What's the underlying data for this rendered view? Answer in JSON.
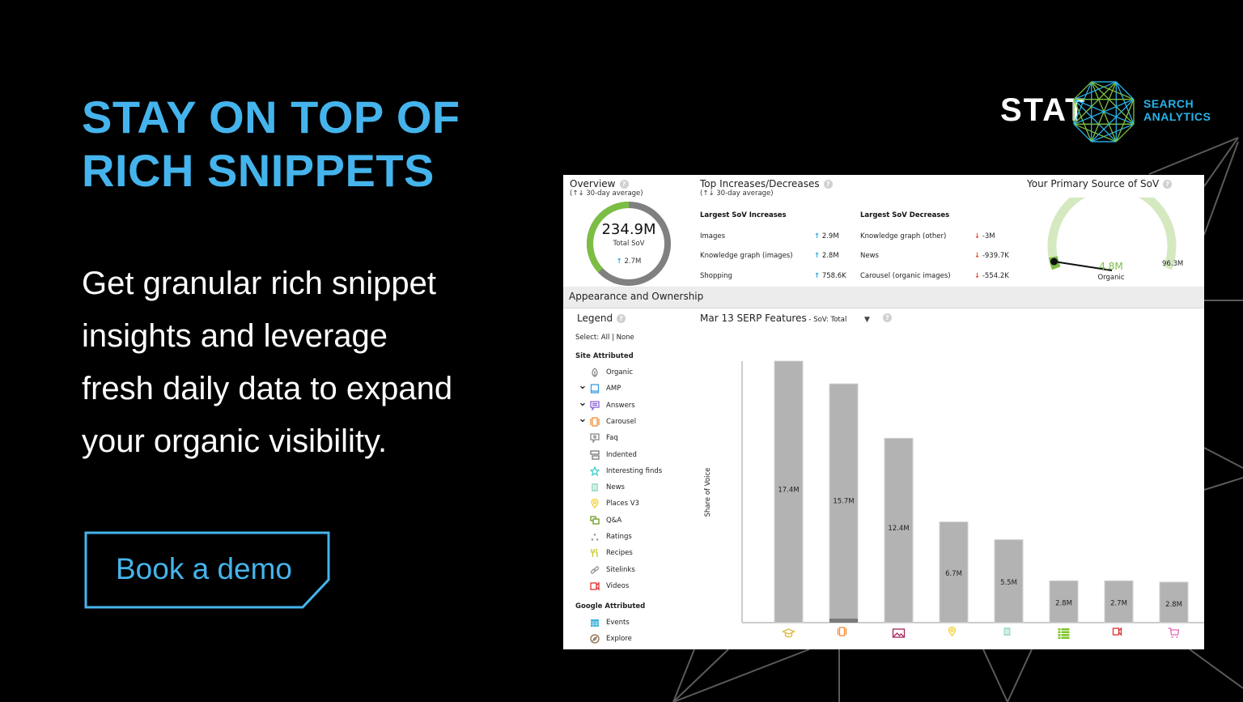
{
  "headline": [
    "STAY ON TOP OF",
    "RICH SNIPPETS"
  ],
  "subcopy": [
    "Get granular rich snippet",
    "insights and leverage",
    "fresh daily data to expand",
    "your organic visibility."
  ],
  "cta": {
    "label": "Book a demo"
  },
  "logo": {
    "wordmark": "STAT",
    "tagline": [
      "SEARCH",
      "ANALYTICS"
    ]
  },
  "colors": {
    "brand_blue": "#45b4ec",
    "green": "#7cbd44",
    "bar_gray": "#b3b3b3",
    "up_arrow": "#25a9e0",
    "down_arrow": "#e8452c"
  },
  "dashboard": {
    "overview": {
      "title": "Overview",
      "note": "(↑↓ 30-day average)",
      "total_value": "234.9M",
      "total_label": "Total SoV",
      "change": "↑ 2.7M",
      "green_fraction": 0.37
    },
    "top_changes": {
      "title": "Top Increases/Decreases",
      "note": "(↑↓ 30-day average)",
      "increases_header": "Largest SoV Increases",
      "decreases_header": "Largest SoV Decreases",
      "increases": [
        {
          "name": "Images",
          "value": "↑ 2.9M"
        },
        {
          "name": "Knowledge graph (images)",
          "value": "↑ 2.8M"
        },
        {
          "name": "Shopping",
          "value": "↑ 758.6K"
        }
      ],
      "decreases": [
        {
          "name": "Knowledge graph (other)",
          "value": "↓ -3M"
        },
        {
          "name": "News",
          "value": "↓ -939.7K"
        },
        {
          "name": "Carousel (organic images)",
          "value": "↓ -554.2K"
        }
      ]
    },
    "primary_source": {
      "title": "Your Primary Source of SoV",
      "value": "4.8M",
      "label": "Organic",
      "max": "96.3M",
      "fraction": 0.05
    },
    "appearance": {
      "title": "Appearance and Ownership",
      "legend_title": "Legend",
      "select_label": "Select: All | None",
      "site_attributed_header": "Site Attributed",
      "site_attributed": [
        {
          "label": "Organic",
          "icon": "leaf-icon",
          "color": "#888888",
          "expandable": false
        },
        {
          "label": "AMP",
          "icon": "amp-icon",
          "color": "#3b9be0",
          "expandable": true
        },
        {
          "label": "Answers",
          "icon": "answers-icon",
          "color": "#8a5fd6",
          "expandable": true
        },
        {
          "label": "Carousel",
          "icon": "carousel-icon",
          "color": "#f28c38",
          "expandable": true
        },
        {
          "label": "Faq",
          "icon": "faq-icon",
          "color": "#888888",
          "expandable": false
        },
        {
          "label": "Indented",
          "icon": "indented-icon",
          "color": "#777777",
          "expandable": false
        },
        {
          "label": "Interesting finds",
          "icon": "star-icon",
          "color": "#3fd1d1",
          "expandable": false
        },
        {
          "label": "News",
          "icon": "news-icon",
          "color": "#7fd1b9",
          "expandable": false
        },
        {
          "label": "Places V3",
          "icon": "map-pin-icon",
          "color": "#f2d024",
          "expandable": false
        },
        {
          "label": "Q&A",
          "icon": "qa-icon",
          "color": "#6a9a1f",
          "expandable": false
        },
        {
          "label": "Ratings",
          "icon": "ratings-icon",
          "color": "#888888",
          "expandable": false
        },
        {
          "label": "Recipes",
          "icon": "recipes-icon",
          "color": "#c8c81e",
          "expandable": false
        },
        {
          "label": "Sitelinks",
          "icon": "link-icon",
          "color": "#999999",
          "expandable": false
        },
        {
          "label": "Videos",
          "icon": "video-icon",
          "color": "#e02f2f",
          "expandable": false
        }
      ],
      "google_attributed_header": "Google Attributed",
      "google_attributed": [
        {
          "label": "Events",
          "icon": "calendar-icon",
          "color": "#3bb0d8",
          "expandable": false
        },
        {
          "label": "Explore",
          "icon": "compass-icon",
          "color": "#8a6a4a",
          "expandable": false
        }
      ],
      "chart_title": "Mar 13 SERP Features",
      "chart_metric": " - SoV: Total"
    }
  },
  "chart_data": {
    "type": "bar",
    "title": "Mar 13 SERP Features - SoV: Total",
    "xlabel": "",
    "ylabel": "Share of Voice",
    "categories": [
      "Knowledge graph",
      "Carousel",
      "Images",
      "Places",
      "News",
      "Sitelinks",
      "Videos",
      "Shopping"
    ],
    "category_icons": [
      "graduation-cap-icon",
      "carousel-icon",
      "image-icon",
      "map-pin-icon",
      "news-icon",
      "list-icon",
      "video-icon",
      "cart-icon"
    ],
    "category_colors": [
      "#e0b93a",
      "#f28c38",
      "#a3205a",
      "#f2d024",
      "#7fd1b9",
      "#7cc62a",
      "#e02f2f",
      "#e066b8"
    ],
    "values": [
      17.4,
      15.7,
      12.4,
      6.7,
      5.5,
      2.8,
      2.7,
      2.8
    ],
    "labels": [
      "17.4M",
      "15.7M",
      "12.4M",
      "6.7M",
      "5.5M",
      "2.8M",
      "2.7M",
      "2.8M"
    ],
    "bar_heights_relative": [
      1.0,
      0.913,
      0.705,
      0.385,
      0.317,
      0.16,
      0.16,
      0.155
    ],
    "units": "M",
    "ylim": [
      0,
      17.4
    ],
    "grid": false,
    "legend": "left"
  }
}
